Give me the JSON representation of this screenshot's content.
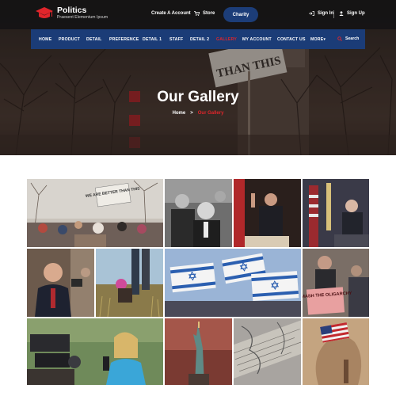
{
  "brand": {
    "name": "Politics",
    "tagline": "Praesent Elementum Ipsum"
  },
  "topbar": {
    "create_account": "Create A Account",
    "store": "Store",
    "charity": "Charity",
    "sign_in": "Sign In",
    "sign_up": "Sign Up"
  },
  "nav": {
    "items": [
      "HOME",
      "PRODUCT",
      "DETAIL",
      "PREFERENCE",
      "DETAIL 1",
      "STAFF",
      "DETAIL 2",
      "GALLERY",
      "MY ACCOUNT",
      "CONTACT US",
      "MORE"
    ],
    "active": "GALLERY",
    "search": "Search"
  },
  "hero": {
    "title": "Our Gallery",
    "breadcrumb_home": "Home",
    "breadcrumb_current": "Our Gallery",
    "sign_text": "THAN THIS"
  },
  "gallery": {
    "images": [
      {
        "name": "protest-crowd-photo",
        "sign_text": "WE ARE BETTER THAN THIS"
      },
      {
        "name": "politicians-black-white-photo"
      },
      {
        "name": "speaker-podium-photo"
      },
      {
        "name": "flag-speech-photo"
      },
      {
        "name": "press-conference-photo"
      },
      {
        "name": "field-grass-photo"
      },
      {
        "name": "israeli-flags-rally-photo"
      },
      {
        "name": "smash-sign-protester-photo",
        "sign_text": "SMASH THE OLIGARCHY"
      },
      {
        "name": "reporter-cameras-photo"
      },
      {
        "name": "statue-of-liberty-photo"
      },
      {
        "name": "map-documents-photo"
      },
      {
        "name": "flag-face-art-photo"
      }
    ]
  },
  "colors": {
    "accent_red": "#e0252b",
    "nav_blue": "#1b3c77",
    "charity_blue": "#1c3d78",
    "topbar_dark": "#121214"
  }
}
